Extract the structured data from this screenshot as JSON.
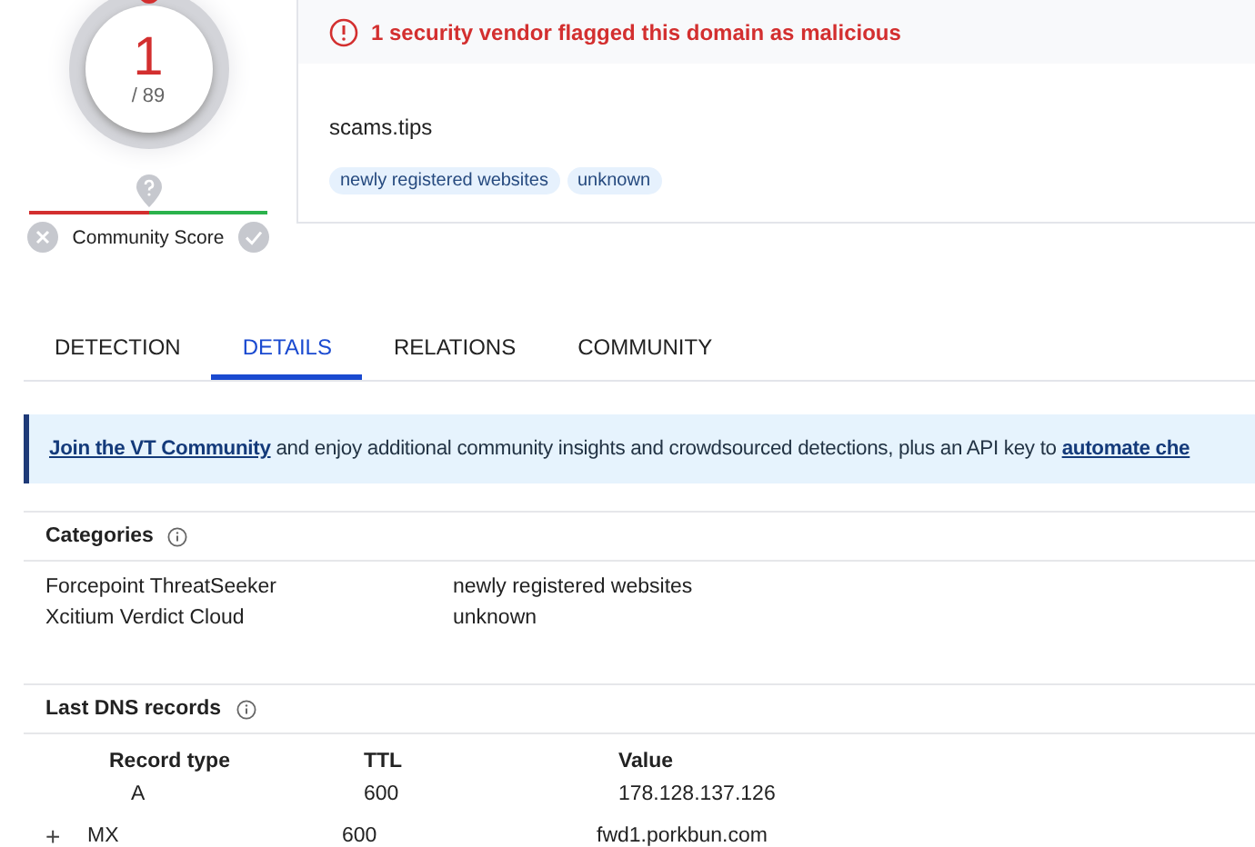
{
  "score": {
    "detections": "1",
    "total": "/ 89"
  },
  "community": {
    "label": "Community Score"
  },
  "alert": {
    "text": "1 security vendor flagged this domain as malicious"
  },
  "domain": {
    "name": "scams.tips",
    "tags": [
      "newly registered websites",
      "unknown"
    ]
  },
  "tabs": [
    {
      "label": "DETECTION",
      "selected": false
    },
    {
      "label": "DETAILS",
      "selected": true
    },
    {
      "label": "RELATIONS",
      "selected": false
    },
    {
      "label": "COMMUNITY",
      "selected": false
    }
  ],
  "banner": {
    "link": "Join the VT Community",
    "text": " and enjoy additional community insights and crowdsourced detections, plus an API key to ",
    "link2": "automate che"
  },
  "categories": {
    "title": "Categories",
    "rows": [
      {
        "vendor": "Forcepoint ThreatSeeker",
        "category": "newly registered websites"
      },
      {
        "vendor": "Xcitium Verdict Cloud",
        "category": "unknown"
      }
    ]
  },
  "dns": {
    "title": "Last DNS records",
    "columns": [
      "Record type",
      "TTL",
      "Value"
    ],
    "rows": [
      {
        "expandable": false,
        "type": "A",
        "ttl": "600",
        "value": "178.128.137.126"
      },
      {
        "expandable": true,
        "expander": "+",
        "type": "MX",
        "ttl": "600",
        "value": "fwd1.porkbun.com"
      }
    ]
  }
}
